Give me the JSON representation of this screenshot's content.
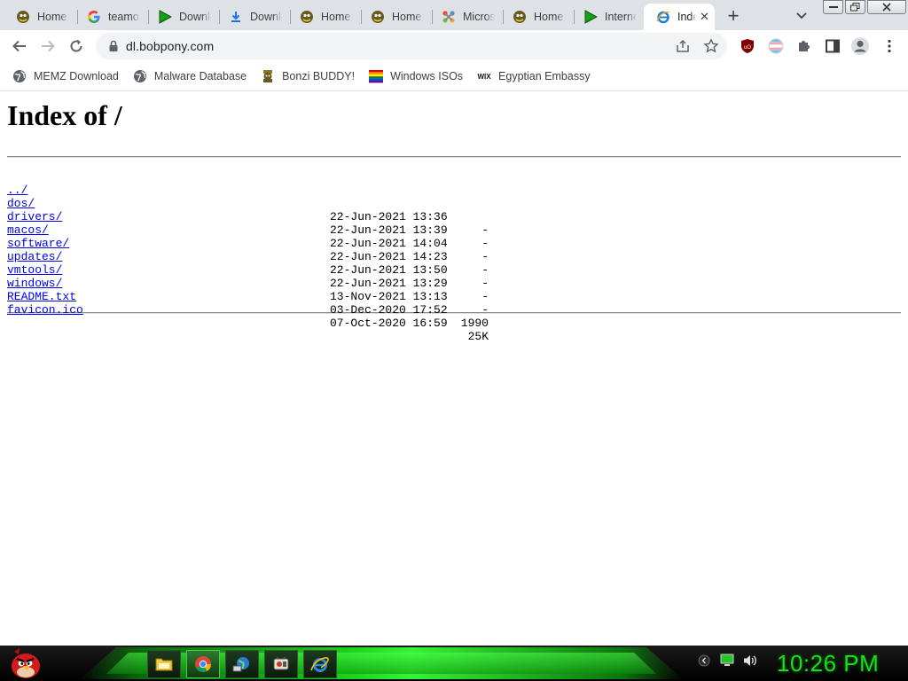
{
  "browser": {
    "tabs": [
      {
        "title": "Home Page",
        "icon": "bonzi-icon"
      },
      {
        "title": "teamos",
        "icon": "google-icon"
      },
      {
        "title": "Download",
        "icon": "play-icon"
      },
      {
        "title": "Download",
        "icon": "download-icon"
      },
      {
        "title": "Home Page",
        "icon": "bonzi-icon"
      },
      {
        "title": "Home Page",
        "icon": "bonzi-icon"
      },
      {
        "title": "Microsoft",
        "icon": "joomla-icon"
      },
      {
        "title": "Home Page",
        "icon": "bonzi-icon"
      },
      {
        "title": "Internet",
        "icon": "play-icon"
      },
      {
        "title": "Index",
        "icon": "ie-icon",
        "active": true
      }
    ],
    "new_tab_label": "+",
    "address": {
      "url": "dl.bobpony.com"
    }
  },
  "bookmarks": [
    {
      "label": "MEMZ Download",
      "icon": "globe-icon"
    },
    {
      "label": "Malware Database",
      "icon": "globe-icon"
    },
    {
      "label": "Bonzi BUDDY!",
      "icon": "bonzi-icon"
    },
    {
      "label": "Windows ISOs",
      "icon": "rainbow-flag-icon"
    },
    {
      "label": "Egyptian Embassy",
      "icon": "wix-icon"
    }
  ],
  "page": {
    "heading": "Index of /",
    "entries": [
      {
        "name": "../",
        "date": "",
        "size": ""
      },
      {
        "name": "dos/",
        "date": "22-Jun-2021 13:36",
        "size": "-"
      },
      {
        "name": "drivers/",
        "date": "22-Jun-2021 13:39",
        "size": "-"
      },
      {
        "name": "macos/",
        "date": "22-Jun-2021 14:04",
        "size": "-"
      },
      {
        "name": "software/",
        "date": "22-Jun-2021 14:23",
        "size": "-"
      },
      {
        "name": "updates/",
        "date": "22-Jun-2021 13:50",
        "size": "-"
      },
      {
        "name": "vmtools/",
        "date": "22-Jun-2021 13:29",
        "size": "-"
      },
      {
        "name": "windows/",
        "date": "13-Nov-2021 13:13",
        "size": "-"
      },
      {
        "name": "README.txt",
        "date": "03-Dec-2020 17:52",
        "size": "1990"
      },
      {
        "name": "favicon.ico",
        "date": "07-Oct-2020 16:59",
        "size": "25K"
      }
    ]
  },
  "taskbar": {
    "clock": "10:26 PM",
    "accent": "#18e018",
    "pinned": [
      {
        "name": "file-explorer-icon"
      },
      {
        "name": "chrome-icon",
        "active": true
      },
      {
        "name": "network-globe-icon"
      },
      {
        "name": "media-app-icon"
      },
      {
        "name": "internet-explorer-icon"
      }
    ]
  }
}
